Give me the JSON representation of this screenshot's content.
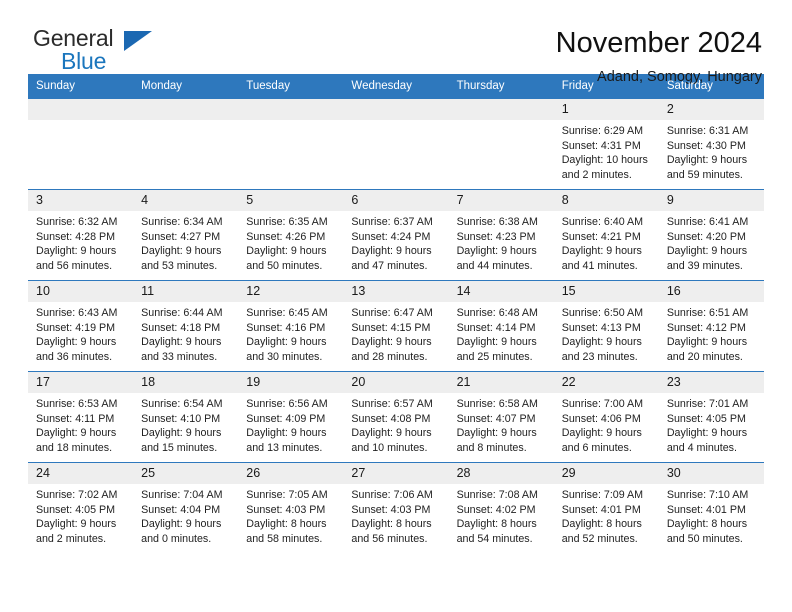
{
  "brand": {
    "name_part1": "General",
    "name_part2": "Blue",
    "accent_color": "#1b76bd",
    "triangle_icon": "triangle-icon"
  },
  "header": {
    "title": "November 2024",
    "subtitle": "Adand, Somogy, Hungary"
  },
  "calendar": {
    "header_bg": "#2e78bd",
    "daynum_bg": "#eeeeee",
    "weekday_headers": [
      "Sunday",
      "Monday",
      "Tuesday",
      "Wednesday",
      "Thursday",
      "Friday",
      "Saturday"
    ],
    "weeks": [
      {
        "days": [
          {
            "num": "",
            "blank": true
          },
          {
            "num": "",
            "blank": true
          },
          {
            "num": "",
            "blank": true
          },
          {
            "num": "",
            "blank": true
          },
          {
            "num": "",
            "blank": true
          },
          {
            "num": "1",
            "sunrise": "Sunrise: 6:29 AM",
            "sunset": "Sunset: 4:31 PM",
            "daylight": "Daylight: 10 hours and 2 minutes."
          },
          {
            "num": "2",
            "sunrise": "Sunrise: 6:31 AM",
            "sunset": "Sunset: 4:30 PM",
            "daylight": "Daylight: 9 hours and 59 minutes."
          }
        ]
      },
      {
        "days": [
          {
            "num": "3",
            "sunrise": "Sunrise: 6:32 AM",
            "sunset": "Sunset: 4:28 PM",
            "daylight": "Daylight: 9 hours and 56 minutes."
          },
          {
            "num": "4",
            "sunrise": "Sunrise: 6:34 AM",
            "sunset": "Sunset: 4:27 PM",
            "daylight": "Daylight: 9 hours and 53 minutes."
          },
          {
            "num": "5",
            "sunrise": "Sunrise: 6:35 AM",
            "sunset": "Sunset: 4:26 PM",
            "daylight": "Daylight: 9 hours and 50 minutes."
          },
          {
            "num": "6",
            "sunrise": "Sunrise: 6:37 AM",
            "sunset": "Sunset: 4:24 PM",
            "daylight": "Daylight: 9 hours and 47 minutes."
          },
          {
            "num": "7",
            "sunrise": "Sunrise: 6:38 AM",
            "sunset": "Sunset: 4:23 PM",
            "daylight": "Daylight: 9 hours and 44 minutes."
          },
          {
            "num": "8",
            "sunrise": "Sunrise: 6:40 AM",
            "sunset": "Sunset: 4:21 PM",
            "daylight": "Daylight: 9 hours and 41 minutes."
          },
          {
            "num": "9",
            "sunrise": "Sunrise: 6:41 AM",
            "sunset": "Sunset: 4:20 PM",
            "daylight": "Daylight: 9 hours and 39 minutes."
          }
        ]
      },
      {
        "days": [
          {
            "num": "10",
            "sunrise": "Sunrise: 6:43 AM",
            "sunset": "Sunset: 4:19 PM",
            "daylight": "Daylight: 9 hours and 36 minutes."
          },
          {
            "num": "11",
            "sunrise": "Sunrise: 6:44 AM",
            "sunset": "Sunset: 4:18 PM",
            "daylight": "Daylight: 9 hours and 33 minutes."
          },
          {
            "num": "12",
            "sunrise": "Sunrise: 6:45 AM",
            "sunset": "Sunset: 4:16 PM",
            "daylight": "Daylight: 9 hours and 30 minutes."
          },
          {
            "num": "13",
            "sunrise": "Sunrise: 6:47 AM",
            "sunset": "Sunset: 4:15 PM",
            "daylight": "Daylight: 9 hours and 28 minutes."
          },
          {
            "num": "14",
            "sunrise": "Sunrise: 6:48 AM",
            "sunset": "Sunset: 4:14 PM",
            "daylight": "Daylight: 9 hours and 25 minutes."
          },
          {
            "num": "15",
            "sunrise": "Sunrise: 6:50 AM",
            "sunset": "Sunset: 4:13 PM",
            "daylight": "Daylight: 9 hours and 23 minutes."
          },
          {
            "num": "16",
            "sunrise": "Sunrise: 6:51 AM",
            "sunset": "Sunset: 4:12 PM",
            "daylight": "Daylight: 9 hours and 20 minutes."
          }
        ]
      },
      {
        "days": [
          {
            "num": "17",
            "sunrise": "Sunrise: 6:53 AM",
            "sunset": "Sunset: 4:11 PM",
            "daylight": "Daylight: 9 hours and 18 minutes."
          },
          {
            "num": "18",
            "sunrise": "Sunrise: 6:54 AM",
            "sunset": "Sunset: 4:10 PM",
            "daylight": "Daylight: 9 hours and 15 minutes."
          },
          {
            "num": "19",
            "sunrise": "Sunrise: 6:56 AM",
            "sunset": "Sunset: 4:09 PM",
            "daylight": "Daylight: 9 hours and 13 minutes."
          },
          {
            "num": "20",
            "sunrise": "Sunrise: 6:57 AM",
            "sunset": "Sunset: 4:08 PM",
            "daylight": "Daylight: 9 hours and 10 minutes."
          },
          {
            "num": "21",
            "sunrise": "Sunrise: 6:58 AM",
            "sunset": "Sunset: 4:07 PM",
            "daylight": "Daylight: 9 hours and 8 minutes."
          },
          {
            "num": "22",
            "sunrise": "Sunrise: 7:00 AM",
            "sunset": "Sunset: 4:06 PM",
            "daylight": "Daylight: 9 hours and 6 minutes."
          },
          {
            "num": "23",
            "sunrise": "Sunrise: 7:01 AM",
            "sunset": "Sunset: 4:05 PM",
            "daylight": "Daylight: 9 hours and 4 minutes."
          }
        ]
      },
      {
        "days": [
          {
            "num": "24",
            "sunrise": "Sunrise: 7:02 AM",
            "sunset": "Sunset: 4:05 PM",
            "daylight": "Daylight: 9 hours and 2 minutes."
          },
          {
            "num": "25",
            "sunrise": "Sunrise: 7:04 AM",
            "sunset": "Sunset: 4:04 PM",
            "daylight": "Daylight: 9 hours and 0 minutes."
          },
          {
            "num": "26",
            "sunrise": "Sunrise: 7:05 AM",
            "sunset": "Sunset: 4:03 PM",
            "daylight": "Daylight: 8 hours and 58 minutes."
          },
          {
            "num": "27",
            "sunrise": "Sunrise: 7:06 AM",
            "sunset": "Sunset: 4:03 PM",
            "daylight": "Daylight: 8 hours and 56 minutes."
          },
          {
            "num": "28",
            "sunrise": "Sunrise: 7:08 AM",
            "sunset": "Sunset: 4:02 PM",
            "daylight": "Daylight: 8 hours and 54 minutes."
          },
          {
            "num": "29",
            "sunrise": "Sunrise: 7:09 AM",
            "sunset": "Sunset: 4:01 PM",
            "daylight": "Daylight: 8 hours and 52 minutes."
          },
          {
            "num": "30",
            "sunrise": "Sunrise: 7:10 AM",
            "sunset": "Sunset: 4:01 PM",
            "daylight": "Daylight: 8 hours and 50 minutes."
          }
        ]
      }
    ]
  }
}
